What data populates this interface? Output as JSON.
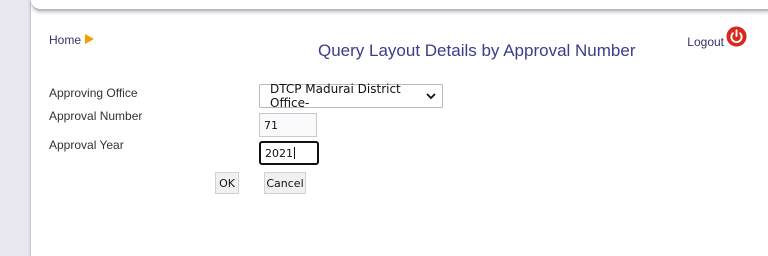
{
  "nav": {
    "home_label": "Home",
    "logout_label": "Logout"
  },
  "page": {
    "title": "Query Layout Details by Approval Number"
  },
  "form": {
    "office_label": "Approving Office",
    "office_selected": "DTCP Madurai District Office-",
    "number_label": "Approval Number",
    "number_value": "71",
    "year_label": "Approval Year",
    "year_value": "2021"
  },
  "buttons": {
    "ok_label": "OK",
    "cancel_label": "Cancel"
  },
  "icons": {
    "home": "play-arrow-icon",
    "logout": "power-icon",
    "select": "chevron-down-icon"
  },
  "colors": {
    "accent": "#3c3c8a",
    "home_arrow": "#f5a000",
    "power": "#d7281e"
  }
}
